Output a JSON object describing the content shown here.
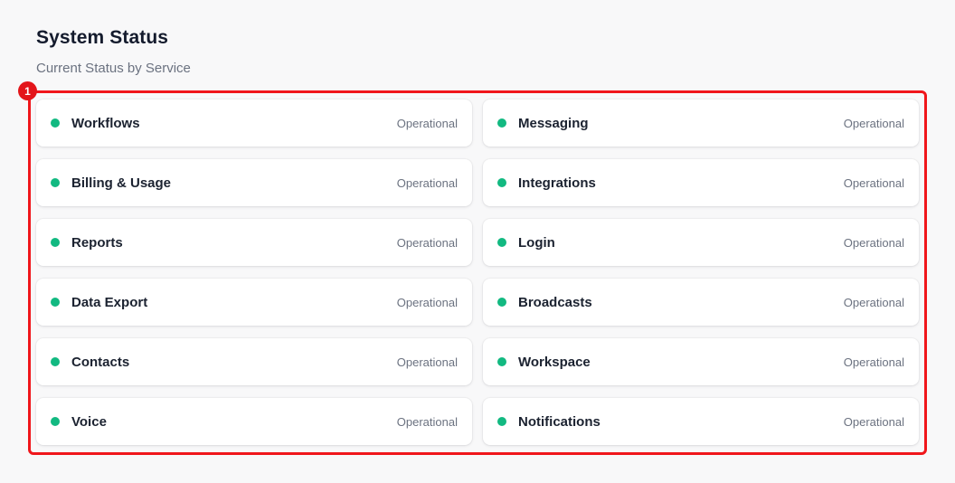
{
  "header": {
    "title": "System Status",
    "subtitle": "Current Status by Service"
  },
  "annotation": {
    "marker_label": "1",
    "highlight_color": "#f0161b"
  },
  "colors": {
    "operational": "#12b981"
  },
  "services": [
    {
      "name": "Workflows",
      "status": "Operational"
    },
    {
      "name": "Messaging",
      "status": "Operational"
    },
    {
      "name": "Billing & Usage",
      "status": "Operational"
    },
    {
      "name": "Integrations",
      "status": "Operational"
    },
    {
      "name": "Reports",
      "status": "Operational"
    },
    {
      "name": "Login",
      "status": "Operational"
    },
    {
      "name": "Data Export",
      "status": "Operational"
    },
    {
      "name": "Broadcasts",
      "status": "Operational"
    },
    {
      "name": "Contacts",
      "status": "Operational"
    },
    {
      "name": "Workspace",
      "status": "Operational"
    },
    {
      "name": "Voice",
      "status": "Operational"
    },
    {
      "name": "Notifications",
      "status": "Operational"
    }
  ]
}
